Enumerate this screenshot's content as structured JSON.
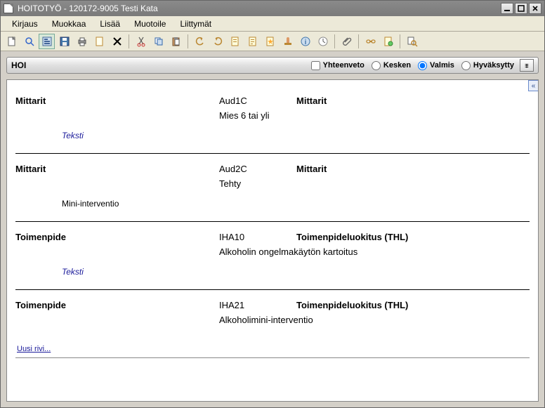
{
  "window": {
    "title": "HOITOTYÖ - 120172-9005 Testi Kata"
  },
  "menu": {
    "items": [
      "Kirjaus",
      "Muokkaa",
      "Lisää",
      "Muotoile",
      "Liittymät"
    ]
  },
  "subheader": {
    "left": "HOI",
    "summary_label": "Yhteenveto",
    "status_options": {
      "kesken": "Kesken",
      "valmis": "Valmis",
      "hyvaksytty": "Hyväksytty"
    },
    "selected_status": "valmis"
  },
  "entries": [
    {
      "label": "Mittarit",
      "code": "Aud1C",
      "classification": "Mittarit",
      "description": "Mies 6 tai yli",
      "note": "Teksti",
      "note_style": "link"
    },
    {
      "label": "Mittarit",
      "code": "Aud2C",
      "classification": "Mittarit",
      "description": "Tehty",
      "note": "Mini-interventio",
      "note_style": "normal"
    },
    {
      "label": "Toimenpide",
      "code": "IHA10",
      "classification": "Toimenpideluokitus (THL)",
      "description": "Alkoholin ongelmakäytön kartoitus",
      "note": "Teksti",
      "note_style": "link"
    },
    {
      "label": "Toimenpide",
      "code": "IHA21",
      "classification": "Toimenpideluokitus (THL)",
      "description": "Alkoholimini-interventio",
      "note": "",
      "note_style": "none"
    }
  ],
  "new_row_label": "Uusi rivi..."
}
